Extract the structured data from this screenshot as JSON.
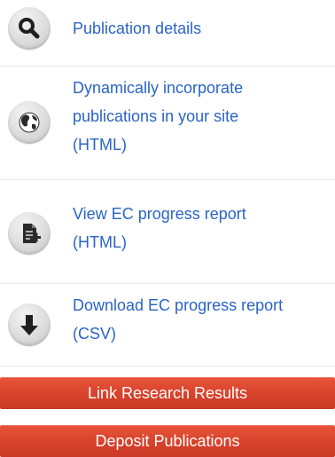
{
  "menu": {
    "items": [
      {
        "label": "Publication details",
        "icon": "search-icon"
      },
      {
        "label": "Dynamically incorporate\npublications in your site\n(HTML)",
        "icon": "globe-icon"
      },
      {
        "label": "View EC progress report\n(HTML)",
        "icon": "document-add-icon"
      },
      {
        "label": "Download EC progress report\n(CSV)",
        "icon": "download-arrow-icon"
      }
    ]
  },
  "actions": {
    "link_research_results": "Link Research Results",
    "deposit_publications": "Deposit Publications"
  },
  "colors": {
    "link": "#2a64c5",
    "button_bg": "#d6402a",
    "button_text": "#ffffff",
    "icon_circle": "#dcdcdc",
    "icon_glyph": "#222222"
  }
}
